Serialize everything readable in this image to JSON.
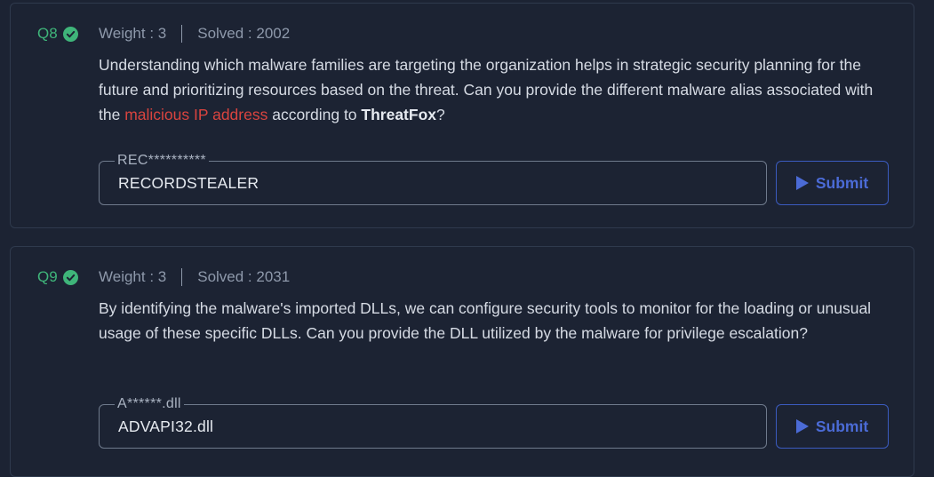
{
  "colors": {
    "background": "#1c2333",
    "solved_green": "#3fb57a",
    "highlight_red": "#d9443f",
    "submit_blue": "#4b6bd6"
  },
  "questions": [
    {
      "label": "Q8",
      "status_icon": "check-circle-icon",
      "weight": "Weight : 3",
      "solved": "Solved : 2002",
      "text_part1": "Understanding which malware families are targeting the organization helps in strategic security planning for the future and prioritizing resources based on the threat. Can you provide the different malware alias associated with the ",
      "text_highlight": "malicious IP address",
      "text_part2": " according to ",
      "text_bold": "ThreatFox",
      "text_part3": "?",
      "answer_hint": "REC**********",
      "answer_value": "RECORDSTEALER",
      "submit_label": "Submit"
    },
    {
      "label": "Q9",
      "status_icon": "check-circle-icon",
      "weight": "Weight : 3",
      "solved": "Solved : 2031",
      "text_part1": "By identifying the malware's imported DLLs, we can configure security tools to monitor for the loading or unusual usage of these specific DLLs. Can you provide the DLL utilized by the malware for privilege escalation?",
      "answer_hint": "A******.dll",
      "answer_value": "ADVAPI32.dll",
      "submit_label": "Submit"
    }
  ]
}
